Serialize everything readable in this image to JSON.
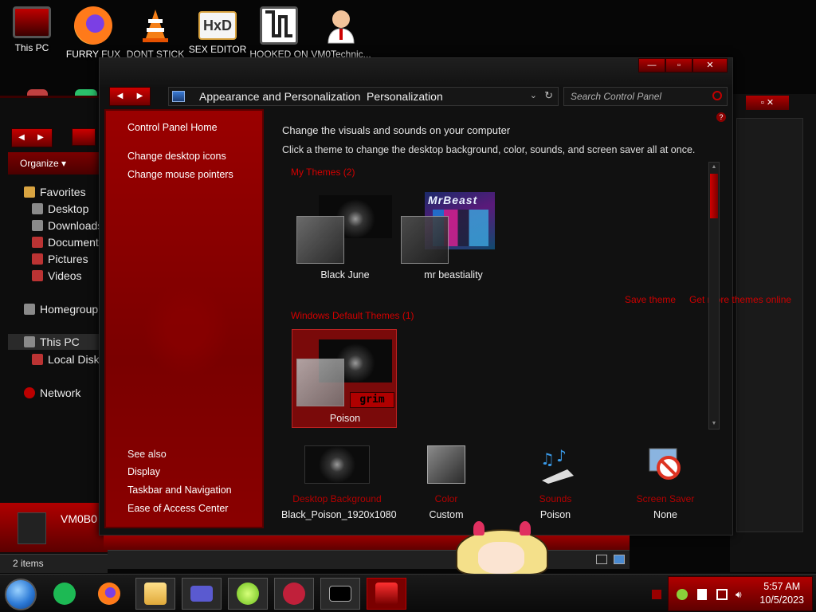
{
  "desktop": {
    "icons": [
      {
        "label": "This PC"
      },
      {
        "label": "FURRY FUX"
      },
      {
        "label": "DONT STICK"
      },
      {
        "label": "SEX EDITOR"
      },
      {
        "label": "HOOKED ON"
      },
      {
        "label": "VM0Technic..."
      }
    ]
  },
  "explorer": {
    "toolbar": {
      "organize": "Organize ▾"
    },
    "tree": {
      "favorites": "Favorites",
      "desktop": "Desktop",
      "downloads": "Downloads",
      "documents": "Documents",
      "pictures": "Pictures",
      "videos": "Videos",
      "homegroup": "Homegroup",
      "this_pc": "This PC",
      "local_disk": "Local Disk",
      "network": "Network"
    },
    "pc_name": "VM0B0",
    "status": "2 items"
  },
  "control_panel": {
    "breadcrumb": [
      "Appearance and Personalization",
      "Personalization"
    ],
    "search_placeholder": "Search Control Panel",
    "left": {
      "home": "Control Panel Home",
      "links": [
        "Change desktop icons",
        "Change mouse pointers"
      ],
      "see_also_title": "See also",
      "see_also": [
        "Display",
        "Taskbar and Navigation",
        "Ease of Access Center"
      ]
    },
    "content": {
      "heading": "Change the visuals and sounds on your computer",
      "subheading": "Click a theme to change the desktop background, color, sounds, and screen saver all at once.",
      "my_themes_title": "My Themes (2)",
      "my_themes": [
        {
          "name": "Black June"
        },
        {
          "name": "mr beastiality"
        }
      ],
      "mr_beast_text": "MrBeast",
      "save_theme": "Save theme",
      "get_more": "Get more themes online",
      "default_themes_title": "Windows Default Themes (1)",
      "default_themes": [
        {
          "name": "Poison",
          "badge": "grim"
        }
      ]
    },
    "options": [
      {
        "title": "Desktop Background",
        "value": "Black_Poison_1920x1080"
      },
      {
        "title": "Color",
        "value": "Custom"
      },
      {
        "title": "Sounds",
        "value": "Poison"
      },
      {
        "title": "Screen Saver",
        "value": "None"
      }
    ]
  },
  "taskbar": {
    "clock_time": "5:57 AM",
    "clock_date": "10/5/2023"
  },
  "colors": {
    "accent": "#b00000",
    "accent_dark": "#6a0000",
    "link_red": "#cc0000",
    "background": "#111111"
  }
}
